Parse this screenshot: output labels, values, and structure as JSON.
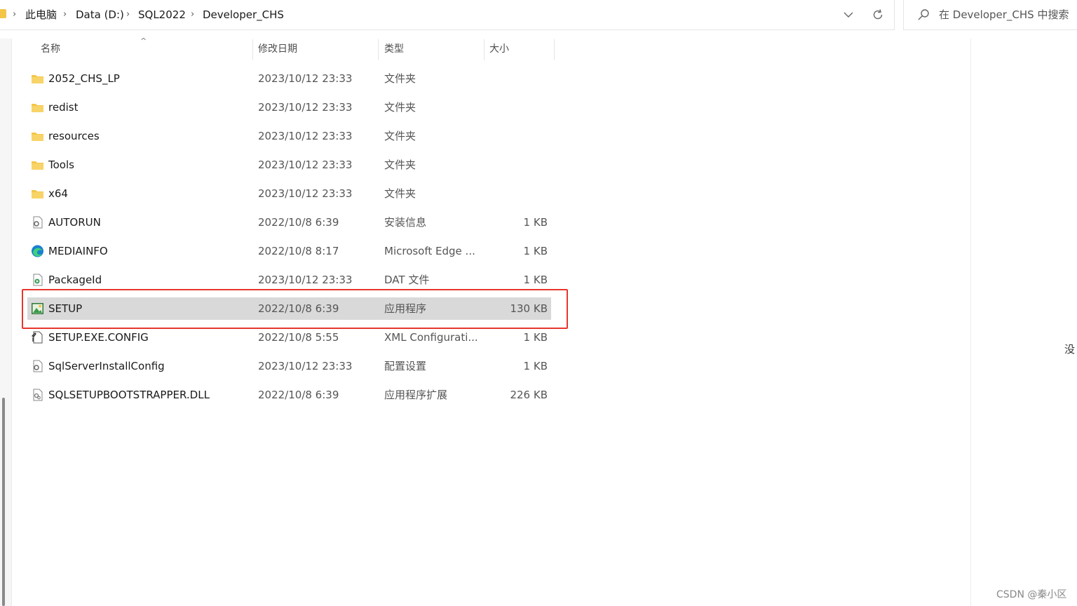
{
  "breadcrumb": {
    "items": [
      "此电脑",
      "Data (D:)",
      "SQL2022",
      "Developer_CHS"
    ]
  },
  "search": {
    "placeholder": "在 Developer_CHS 中搜索"
  },
  "columns": {
    "name": "名称",
    "date": "修改日期",
    "type": "类型",
    "size": "大小"
  },
  "files": [
    {
      "name": "2052_CHS_LP",
      "date": "2023/10/12 23:33",
      "type": "文件夹",
      "size": "",
      "icon": "folder-icon"
    },
    {
      "name": "redist",
      "date": "2023/10/12 23:33",
      "type": "文件夹",
      "size": "",
      "icon": "folder-icon"
    },
    {
      "name": "resources",
      "date": "2023/10/12 23:33",
      "type": "文件夹",
      "size": "",
      "icon": "folder-icon"
    },
    {
      "name": "Tools",
      "date": "2023/10/12 23:33",
      "type": "文件夹",
      "size": "",
      "icon": "folder-icon"
    },
    {
      "name": "x64",
      "date": "2023/10/12 23:33",
      "type": "文件夹",
      "size": "",
      "icon": "folder-icon"
    },
    {
      "name": "AUTORUN",
      "date": "2022/10/8 6:39",
      "type": "安装信息",
      "size": "1 KB",
      "icon": "settings-file-icon"
    },
    {
      "name": "MEDIAINFO",
      "date": "2022/10/8 8:17",
      "type": "Microsoft Edge ...",
      "size": "1 KB",
      "icon": "edge-icon"
    },
    {
      "name": "PackageId",
      "date": "2023/10/12 23:33",
      "type": "DAT 文件",
      "size": "1 KB",
      "icon": "media-file-icon"
    },
    {
      "name": "SETUP",
      "date": "2022/10/8 6:39",
      "type": "应用程序",
      "size": "130 KB",
      "icon": "setup-app-icon",
      "selected": true
    },
    {
      "name": "SETUP.EXE.CONFIG",
      "date": "2022/10/8 5:55",
      "type": "XML Configurati...",
      "size": "1 KB",
      "icon": "config-file-icon"
    },
    {
      "name": "SqlServerInstallConfig",
      "date": "2023/10/12 23:33",
      "type": "配置设置",
      "size": "1 KB",
      "icon": "settings-file-icon"
    },
    {
      "name": "SQLSETUPBOOTSTRAPPER.DLL",
      "date": "2022/10/8 6:39",
      "type": "应用程序扩展",
      "size": "226 KB",
      "icon": "dll-file-icon"
    }
  ],
  "details_pane_text": "没",
  "watermark": "CSDN @秦小区",
  "colors": {
    "highlight": "#e8362c",
    "selected_row": "#d9d9d9",
    "folder": "#f3c64a"
  }
}
